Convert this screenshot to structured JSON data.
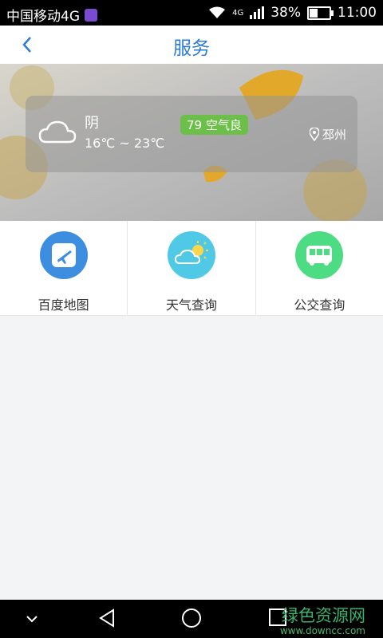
{
  "status_bar": {
    "carrier": "中国移动4G",
    "network": "4G",
    "battery": "38%",
    "battery_level": 0.38,
    "time": "11:00"
  },
  "header": {
    "title": "服务",
    "back_icon": "chevron-left-icon"
  },
  "weather": {
    "condition": "阴",
    "temperature": "16℃ ~ 23℃",
    "aqi": "79 空气良",
    "location": "邳州",
    "weather_icon": "cloud-icon",
    "location_icon": "location-pin-icon"
  },
  "services": [
    {
      "label": "百度地图",
      "icon": "airplane-icon",
      "color": "#3d8ee0"
    },
    {
      "label": "天气查询",
      "icon": "partly-sunny-icon",
      "color": "#4fc9e6"
    },
    {
      "label": "公交查询",
      "icon": "bus-icon",
      "color": "#4ddb84"
    }
  ],
  "nav": {
    "icons": [
      "chevron-down-icon",
      "back-triangle-icon",
      "home-circle-icon",
      "recent-square-icon"
    ]
  },
  "watermark": {
    "title": "绿色资源网",
    "url": "www.downcc.com"
  }
}
